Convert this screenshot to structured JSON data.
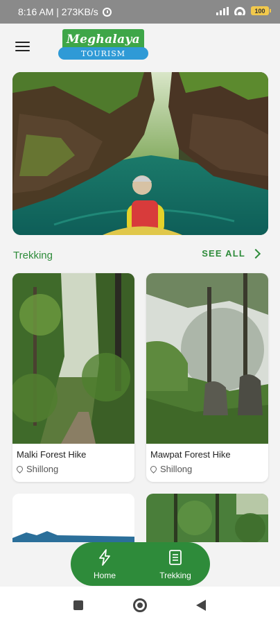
{
  "status_bar": {
    "time_speed": "8:16 AM | 273KB/s",
    "battery": "100"
  },
  "app": {
    "logo_main": "Meghalaya",
    "logo_sub": "TOURISM"
  },
  "section": {
    "title": "Trekking",
    "see_all": "SEE ALL"
  },
  "cards": [
    {
      "title": "Malki Forest Hike",
      "location": "Shillong"
    },
    {
      "title": "Mawpat Forest Hike",
      "location": "Shillong"
    }
  ],
  "bottom_nav": {
    "items": [
      {
        "label": "Home",
        "icon": "lightning-icon"
      },
      {
        "label": "Trekking",
        "icon": "document-icon"
      }
    ]
  },
  "colors": {
    "accent": "#2e8b3a",
    "status_bar": "#8a8a8a"
  }
}
